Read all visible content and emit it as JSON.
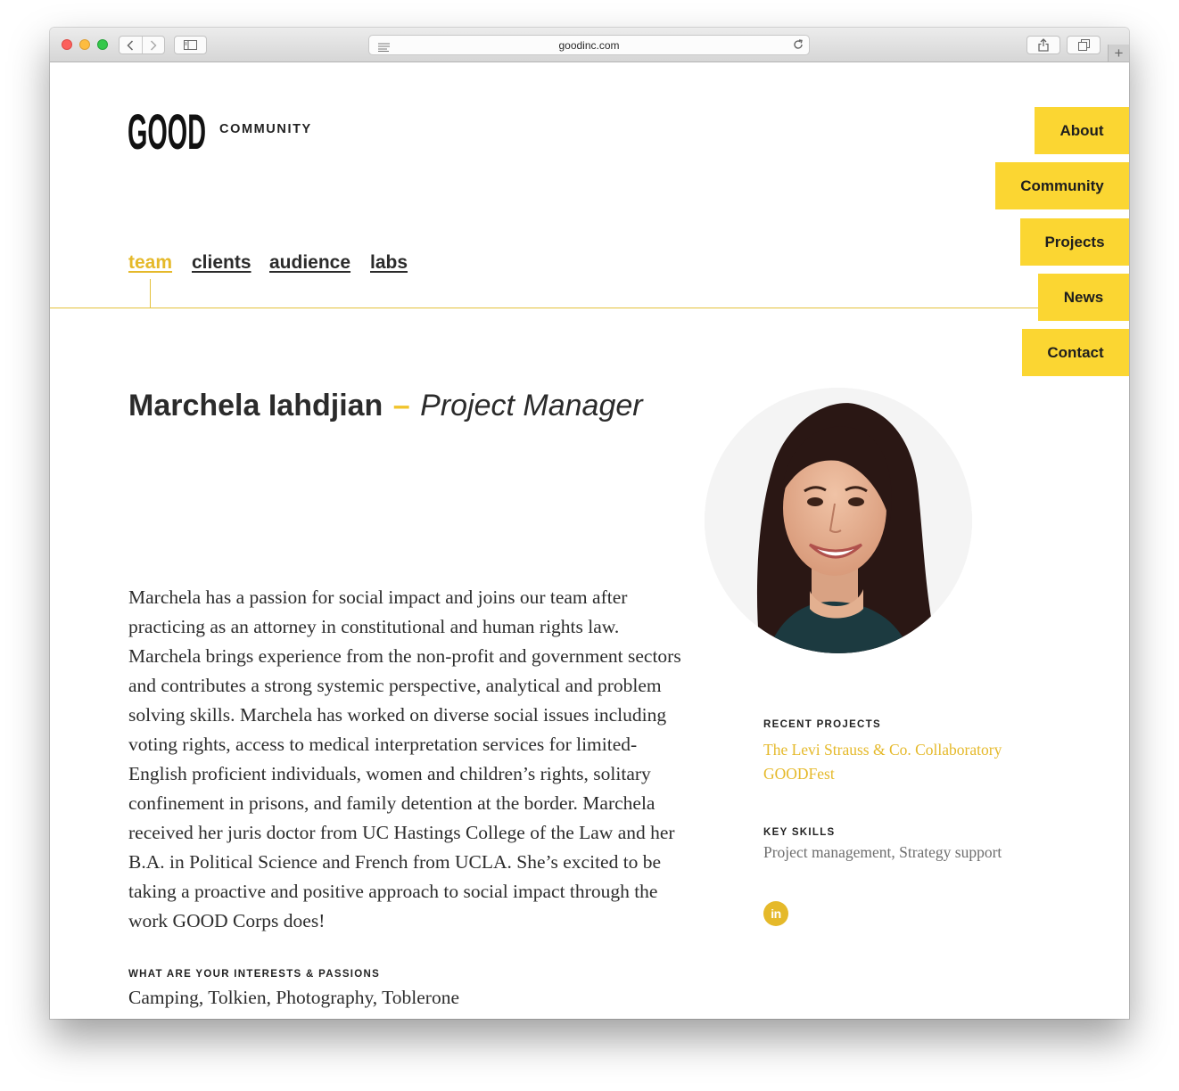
{
  "browser": {
    "url": "goodinc.com",
    "nav_icons": [
      "back-icon",
      "forward-icon"
    ],
    "sidebar_icon": "sidebar-icon",
    "share_icon": "share-icon",
    "tabs_icon": "tabs-overview-icon",
    "new_tab_label": "+"
  },
  "site": {
    "logo_text": "GOOD",
    "section_label": "COMMUNITY",
    "accent_color": "#fbd632",
    "link_color": "#e5b92a"
  },
  "main_nav": [
    {
      "label": "About"
    },
    {
      "label": "Community"
    },
    {
      "label": "Projects"
    },
    {
      "label": "News"
    },
    {
      "label": "Contact"
    }
  ],
  "sub_nav": [
    {
      "label": "team",
      "active": true
    },
    {
      "label": "clients",
      "active": false
    },
    {
      "label": "audience",
      "active": false
    },
    {
      "label": "labs",
      "active": false
    }
  ],
  "profile": {
    "name": "Marchela Iahdjian",
    "dash": "–",
    "role": "Project Manager",
    "bio": "Marchela has a passion for social impact and joins our team after practicing as an attorney in constitutional and human rights law. Marchela brings experience from the non-profit and government sectors and contributes a strong systemic perspective, analytical and problem solving skills. Marchela has worked on diverse social issues including voting rights, access to medical interpretation services for limited-English proficient individuals, women and children’s rights, solitary confinement in prisons, and family detention at the border. Marchela received her juris doctor from UC Hastings College of the Law and her B.A. in Political Science and French from UCLA. She’s excited to be taking a proactive and positive approach to social impact through the work GOOD Corps does!",
    "interests_label": "WHAT ARE YOUR INTERESTS & PASSIONS",
    "interests": "Camping, Tolkien, Photography, Toblerone",
    "photo_icon": "portrait-photo"
  },
  "sidebar": {
    "recent_projects_label": "RECENT PROJECTS",
    "projects": [
      {
        "label": "The Levi Strauss & Co. Collaboratory"
      },
      {
        "label": "GOODFest"
      }
    ],
    "key_skills_label": "KEY SKILLS",
    "key_skills": "Project management, Strategy support",
    "social_icon": "linkedin-icon",
    "social_text": "in"
  }
}
